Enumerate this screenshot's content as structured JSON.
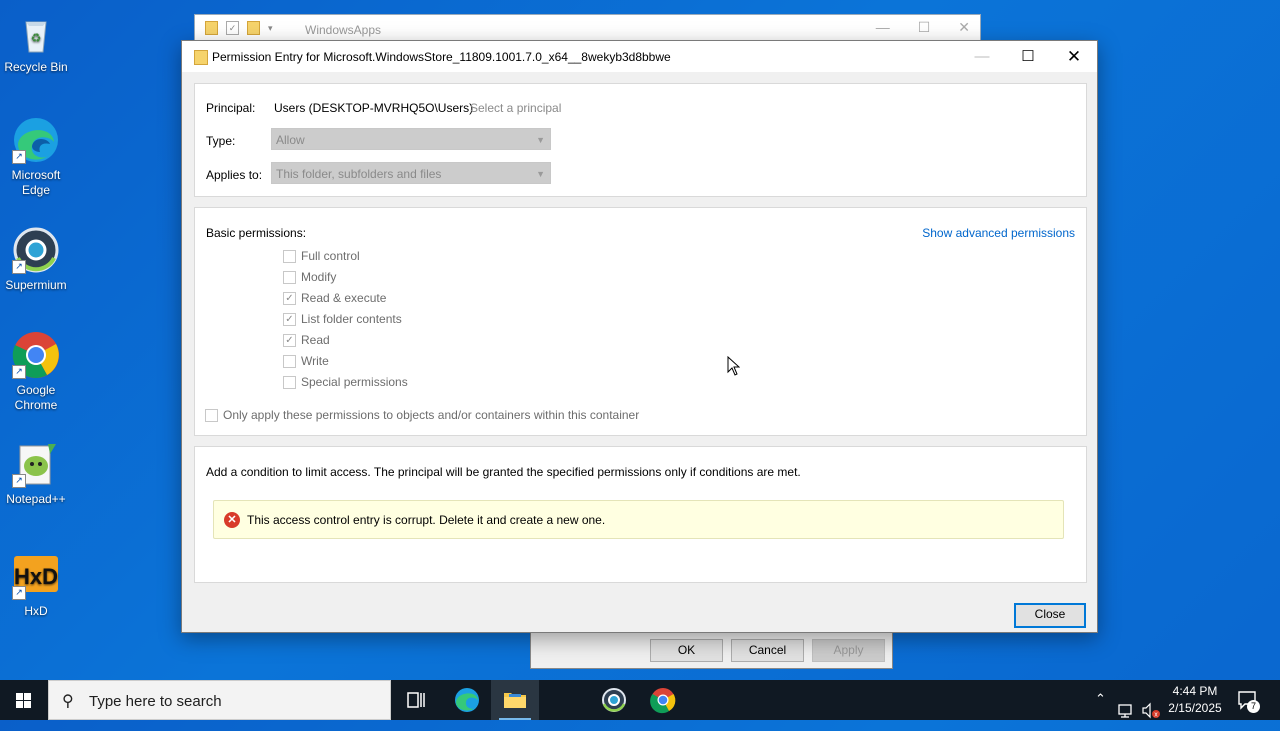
{
  "desktop": {
    "icons": [
      {
        "label": "Recycle Bin"
      },
      {
        "label": "Microsoft Edge"
      },
      {
        "label": "Supermium"
      },
      {
        "label": "Google Chrome"
      },
      {
        "label": "Notepad++"
      },
      {
        "label": "HxD"
      }
    ]
  },
  "background_window": {
    "title": "WindowsApps"
  },
  "security_dialog": {
    "ok": "OK",
    "cancel": "Cancel",
    "apply": "Apply"
  },
  "dialog": {
    "title": "Permission Entry for Microsoft.WindowsStore_11809.1001.7.0_x64__8wekyb3d8bbwe",
    "principal_label": "Principal:",
    "principal_value": "Users (DESKTOP-MVRHQ5O\\Users)",
    "select_principal": "Select a principal",
    "type_label": "Type:",
    "type_value": "Allow",
    "applies_label": "Applies to:",
    "applies_value": "This folder, subfolders and files",
    "basic_permissions_label": "Basic permissions:",
    "show_advanced": "Show advanced permissions",
    "permissions": [
      {
        "label": "Full control",
        "checked": false
      },
      {
        "label": "Modify",
        "checked": false
      },
      {
        "label": "Read & execute",
        "checked": true
      },
      {
        "label": "List folder contents",
        "checked": true
      },
      {
        "label": "Read",
        "checked": true
      },
      {
        "label": "Write",
        "checked": false
      },
      {
        "label": "Special permissions",
        "checked": false
      }
    ],
    "only_apply": "Only apply these permissions to objects and/or containers within this container",
    "condition_text": "Add a condition to limit access. The principal will be granted the specified permissions only if conditions are met.",
    "error_text": "This access control entry is corrupt. Delete it and create a new one.",
    "close_button": "Close"
  },
  "taskbar": {
    "search_placeholder": "Type here to search",
    "time": "4:44 PM",
    "date": "2/15/2025",
    "notification_count": "7"
  }
}
